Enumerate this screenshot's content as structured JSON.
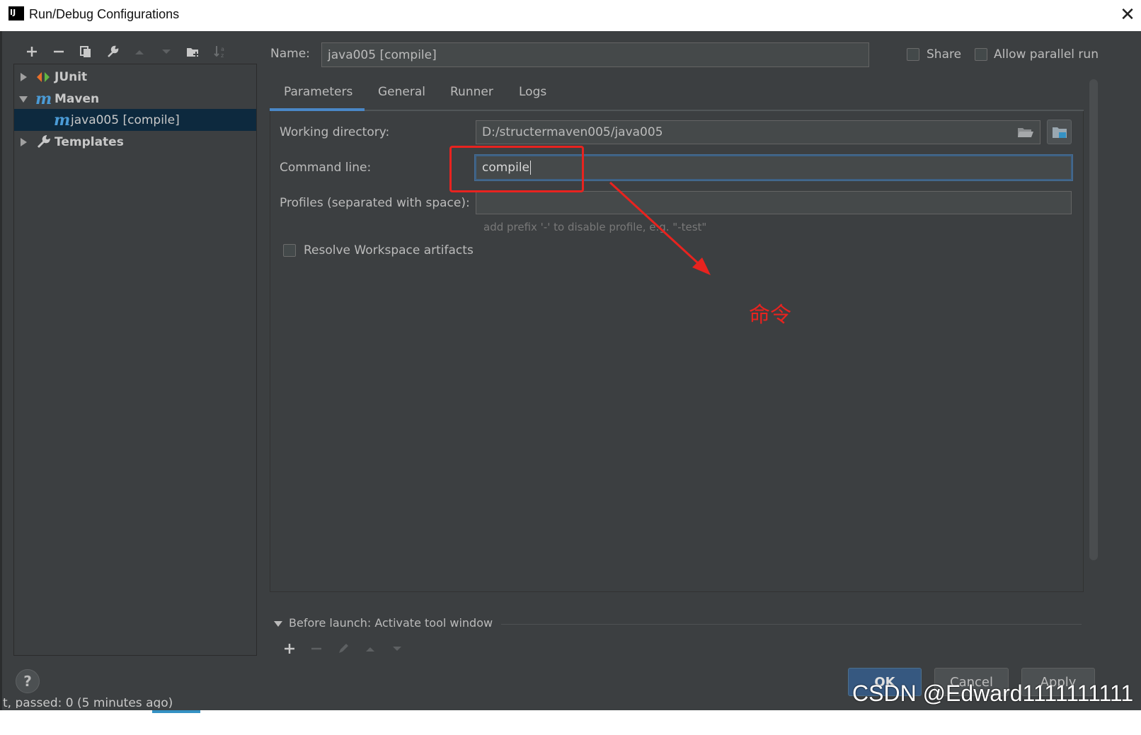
{
  "window": {
    "title": "Run/Debug Configurations",
    "close_glyph": "✕"
  },
  "toolbar": {
    "icons": [
      "plus-icon",
      "minus-icon",
      "copy-icon",
      "wrench-icon",
      "arrow-up-icon",
      "arrow-down-icon",
      "new-folder-icon",
      "sort-icon"
    ]
  },
  "tree": {
    "items": [
      {
        "label": "JUnit",
        "icon": "junit-icon",
        "expanded": false
      },
      {
        "label": "Maven",
        "icon": "maven-icon",
        "expanded": true
      },
      {
        "label": "java005 [compile]",
        "icon": "maven-icon",
        "selected": true
      },
      {
        "label": "Templates",
        "icon": "wrench-icon",
        "expanded": false
      }
    ]
  },
  "name": {
    "label": "Name:",
    "value": "java005 [compile]"
  },
  "options": {
    "share_label": "Share",
    "share_checked": false,
    "parallel_label": "Allow parallel run",
    "parallel_checked": false
  },
  "tabs": [
    {
      "label": "Parameters",
      "active": true
    },
    {
      "label": "General",
      "active": false
    },
    {
      "label": "Runner",
      "active": false
    },
    {
      "label": "Logs",
      "active": false
    }
  ],
  "parameters": {
    "working_dir_label": "Working directory:",
    "working_dir_value": "D:/structermaven005/java005",
    "command_label": "Command line:",
    "command_value": "compile",
    "profiles_label": "Profiles (separated with space):",
    "profiles_value": "",
    "profiles_hint": "add prefix '-' to disable profile, e.g. \"-test\"",
    "resolve_label": "Resolve Workspace artifacts",
    "resolve_checked": false
  },
  "before_launch": {
    "label": "Before launch: Activate tool window"
  },
  "buttons": {
    "ok": "OK",
    "cancel": "Cancel",
    "apply": "Apply",
    "help": "?"
  },
  "status_bar": {
    "text": "t, passed: 0 (5 minutes ago)"
  },
  "annotation": {
    "label": "命令",
    "color": "#e8231f"
  },
  "watermark": "CSDN @Edward1111111111",
  "colors": {
    "background": "#3c3f41",
    "accent": "#4a88c7",
    "selection": "#0d293e",
    "primary_button": "#365880"
  }
}
